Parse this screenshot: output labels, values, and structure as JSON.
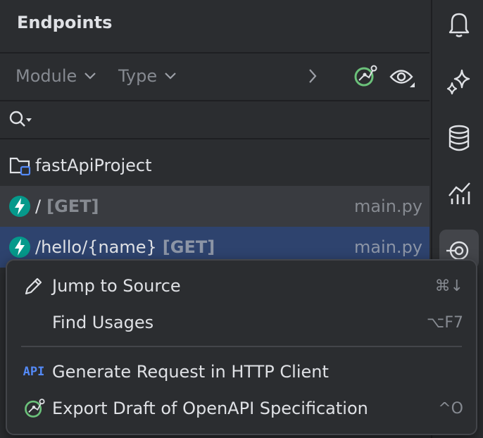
{
  "panel": {
    "title": "Endpoints",
    "filters": {
      "module_label": "Module",
      "type_label": "Type"
    }
  },
  "tree": {
    "project": "fastApiProject",
    "endpoints": [
      {
        "path": "/",
        "method": "[GET]",
        "file": "main.py",
        "selected": false
      },
      {
        "path": "/hello/{name}",
        "method": "[GET]",
        "file": "main.py",
        "selected": true
      }
    ]
  },
  "context_menu": {
    "items": [
      {
        "label": "Jump to Source",
        "shortcut": "⌘↓",
        "icon": "pencil-icon"
      },
      {
        "label": "Find Usages",
        "shortcut": "⌥F7",
        "icon": ""
      },
      {
        "label": "Generate Request in HTTP Client",
        "shortcut": "",
        "icon": "api-icon",
        "icon_text": "API"
      },
      {
        "label": "Export Draft of OpenAPI Specification",
        "shortcut": "^O",
        "icon": "openapi-icon"
      }
    ]
  },
  "sidebar": {
    "icons": [
      "bell-icon",
      "ai-sparkle-icon",
      "database-icon",
      "profiler-chart-icon",
      "endpoints-icon"
    ],
    "active": "endpoints-icon"
  },
  "colors": {
    "panel_bg": "#2B2D30",
    "selection_bg": "#2E436E",
    "hover_bg": "#393B40",
    "fastapi_teal": "#05998B",
    "openapi_green": "#6BC17A",
    "api_blue": "#548AF7"
  }
}
